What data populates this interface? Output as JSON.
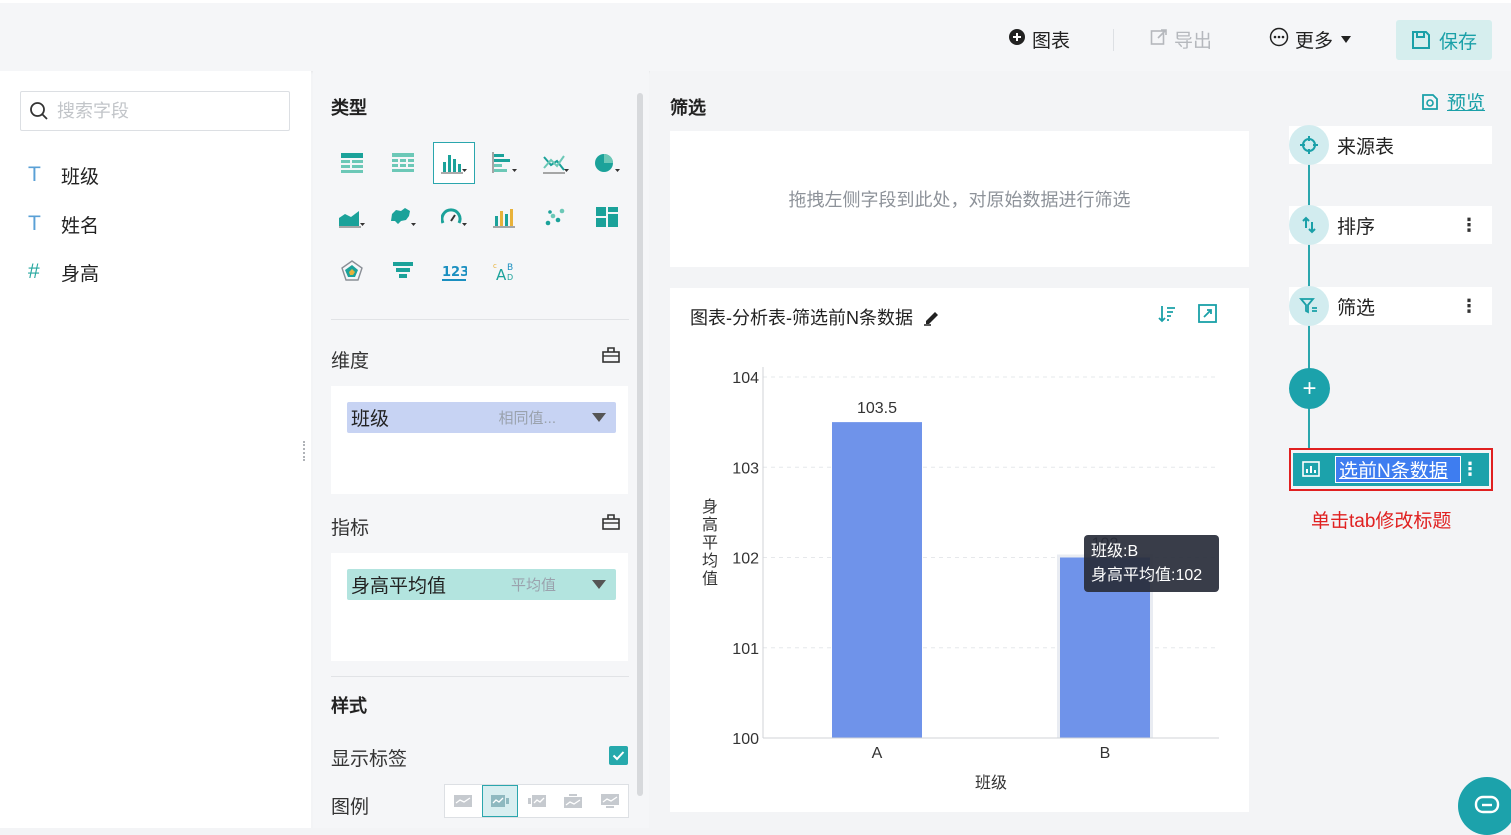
{
  "toolbar": {
    "chart_label": "图表",
    "export_label": "导出",
    "more_label": "更多",
    "save_label": "保存"
  },
  "fields_panel": {
    "search_placeholder": "搜索字段",
    "fields": [
      {
        "type": "T",
        "name": "班级"
      },
      {
        "type": "T",
        "name": "姓名"
      },
      {
        "type": "#",
        "name": "身高"
      }
    ]
  },
  "config": {
    "type_title": "类型",
    "dimension_label": "维度",
    "dimension_pill": {
      "name": "班级",
      "sub": "相同值..."
    },
    "metric_label": "指标",
    "metric_pill": {
      "name": "身高平均值",
      "sub": "平均值"
    },
    "style_title": "样式",
    "show_label": "显示标签",
    "legend_label": "图例"
  },
  "main": {
    "filter_title": "筛选",
    "filter_placeholder": "拖拽左侧字段到此处，对原始数据进行筛选",
    "chart_title": "图表-分析表-筛选前N条数据"
  },
  "chart_data": {
    "type": "bar",
    "categories": [
      "A",
      "B"
    ],
    "values": [
      103.5,
      102
    ],
    "xlabel": "班级",
    "ylabel": "身高平均值",
    "ylim": [
      100,
      104
    ],
    "yticks": [
      100,
      101,
      102,
      103,
      104
    ],
    "data_labels": [
      "103.5",
      "102"
    ],
    "bar_color": "#6f93ea",
    "grid": true,
    "tooltip": {
      "line1": "班级:B",
      "line2": "身高平均值:102"
    }
  },
  "pipeline": {
    "preview_label": "预览",
    "nodes": [
      {
        "label": "来源表"
      },
      {
        "label": "排序"
      },
      {
        "label": "筛选"
      }
    ],
    "active_node_label": "选前N条数据",
    "hint": "单击tab修改标题"
  },
  "colors": {
    "accent": "#1ca2ab",
    "hint_red": "#e02020",
    "bar": "#6f93ea"
  }
}
